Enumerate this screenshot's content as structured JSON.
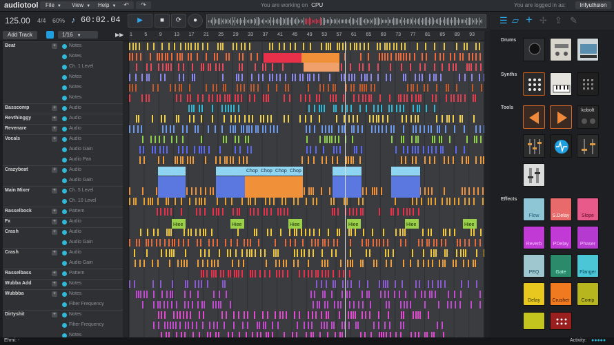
{
  "app": {
    "logo": "audiotool"
  },
  "menu": {
    "file": "File",
    "view": "View",
    "help": "Help",
    "undo": "↶",
    "redo": "↷"
  },
  "status": {
    "working_label": "You are working on",
    "working_value": "CPU",
    "logged_label": "You are logged in as:",
    "user": "Infyuthsion"
  },
  "transport": {
    "tempo": "125.00",
    "signature": "4/4",
    "swing": "60%",
    "time": "60:02.04",
    "play": "▶",
    "stop": "■",
    "loop": "⟳",
    "record": "●"
  },
  "toolbar": {
    "add_track": "Add Track",
    "grid": "1/16"
  },
  "ruler": [
    "1",
    "5",
    "9",
    "13",
    "17",
    "21",
    "25",
    "29",
    "33",
    "37",
    "41",
    "45",
    "49",
    "53",
    "57",
    "61",
    "65",
    "69",
    "73",
    "77",
    "81",
    "85",
    "89",
    "93",
    "9"
  ],
  "tracks": [
    {
      "name": "Beat",
      "param": "Notes"
    },
    {
      "name": "",
      "param": "Notes"
    },
    {
      "name": "",
      "param": "Ch. 1 Level"
    },
    {
      "name": "",
      "param": "Notes"
    },
    {
      "name": "",
      "param": "Notes"
    },
    {
      "name": "",
      "param": "Notes"
    },
    {
      "name": "Basscomp",
      "param": "Audio"
    },
    {
      "name": "Revthinggy",
      "param": "Audio"
    },
    {
      "name": "Revenare",
      "param": "Audio"
    },
    {
      "name": "Vocals",
      "param": "Audio"
    },
    {
      "name": "",
      "param": "Audio Gain"
    },
    {
      "name": "",
      "param": "Audio Pan"
    },
    {
      "name": "Crazybeat",
      "param": "Audio"
    },
    {
      "name": "",
      "param": "Audio Gain"
    },
    {
      "name": "Main Mixer",
      "param": "Ch. 5 Level"
    },
    {
      "name": "",
      "param": "Ch. 10 Level"
    },
    {
      "name": "Rasselbock",
      "param": "Pattern"
    },
    {
      "name": "Fx",
      "param": "Audio"
    },
    {
      "name": "Crash",
      "param": "Audio"
    },
    {
      "name": "",
      "param": "Audio Gain"
    },
    {
      "name": "Crash",
      "param": "Audio"
    },
    {
      "name": "",
      "param": "Audio Gain"
    },
    {
      "name": "Rasselbass",
      "param": "Pattern"
    },
    {
      "name": "Wubba Add",
      "param": "Notes"
    },
    {
      "name": "Wubbba",
      "param": "Notes"
    },
    {
      "name": "",
      "param": "Filter Frequency"
    },
    {
      "name": "Dirtyshit",
      "param": "Notes"
    },
    {
      "name": "",
      "param": "Filter Frequency"
    },
    {
      "name": "",
      "param": "Notes"
    }
  ],
  "clips": {
    "chop": "Chop",
    "hiee": "Hiee"
  },
  "sidebar": {
    "drums": "Drums",
    "synths": "Synths",
    "tools": "Tools",
    "effects": "Effects",
    "tool_kobolt": "kobolt",
    "effects_items": [
      "Flow",
      "S.Delay",
      "Slope",
      "Reverb",
      "PDelay",
      "Phaser",
      "PEQ",
      "Gate",
      "Flanger",
      "Delay",
      "Crusher",
      "Comp"
    ]
  },
  "bottom": {
    "left": "Ehmi: -",
    "activity": "Activity:"
  },
  "colors": {
    "accent": "#1f9fe0",
    "track_dot": "#2fb8d8",
    "bg": "#1b1d20"
  }
}
